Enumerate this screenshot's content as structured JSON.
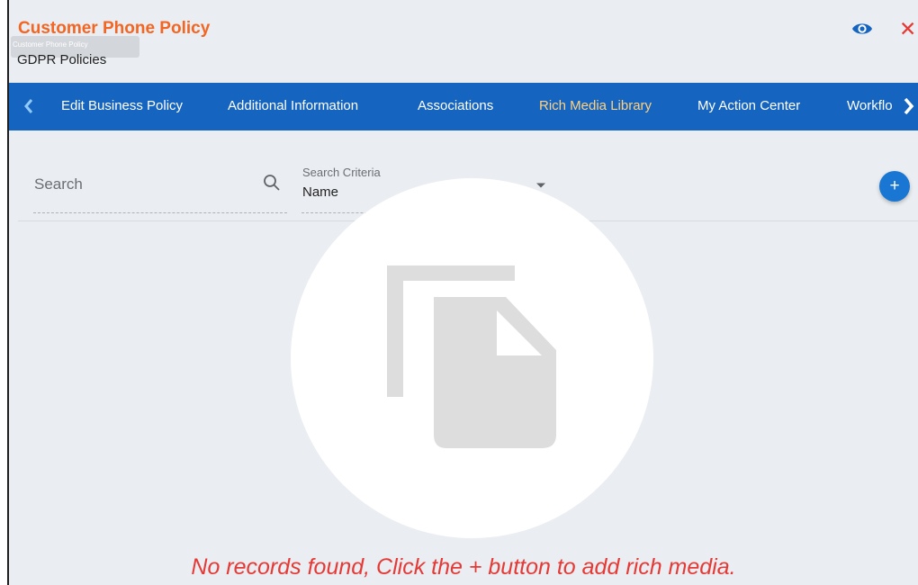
{
  "header": {
    "title": "Customer Phone Policy",
    "ghost_text": "Customer Phone Policy",
    "subtitle": "GDPR Policies",
    "close_glyph": "✕",
    "view_icon": "eye-icon",
    "close_icon": "close-icon"
  },
  "nav": {
    "prev_icon": "chevron-left-icon",
    "next_icon": "chevron-right-icon",
    "tabs": [
      {
        "label": "Edit Business Policy",
        "active": false
      },
      {
        "label": "Additional Information",
        "active": false
      },
      {
        "label": "Associations",
        "active": false
      },
      {
        "label": "Rich Media Library",
        "active": true
      },
      {
        "label": "My Action Center",
        "active": false
      },
      {
        "label": "Workflo",
        "active": false
      }
    ]
  },
  "toolbar": {
    "search_placeholder": "Search",
    "criteria_label": "Search Criteria",
    "criteria_value": "Name",
    "add_label": "+"
  },
  "empty_state": {
    "icon": "document-copy-icon",
    "message": "No records found, Click the + button to add rich media."
  },
  "colors": {
    "title": "#f26522",
    "nav_bg": "#1565c0",
    "active_tab": "#ffd180",
    "accent": "#1976d2",
    "error": "#e53935",
    "background": "#eaedf1"
  }
}
